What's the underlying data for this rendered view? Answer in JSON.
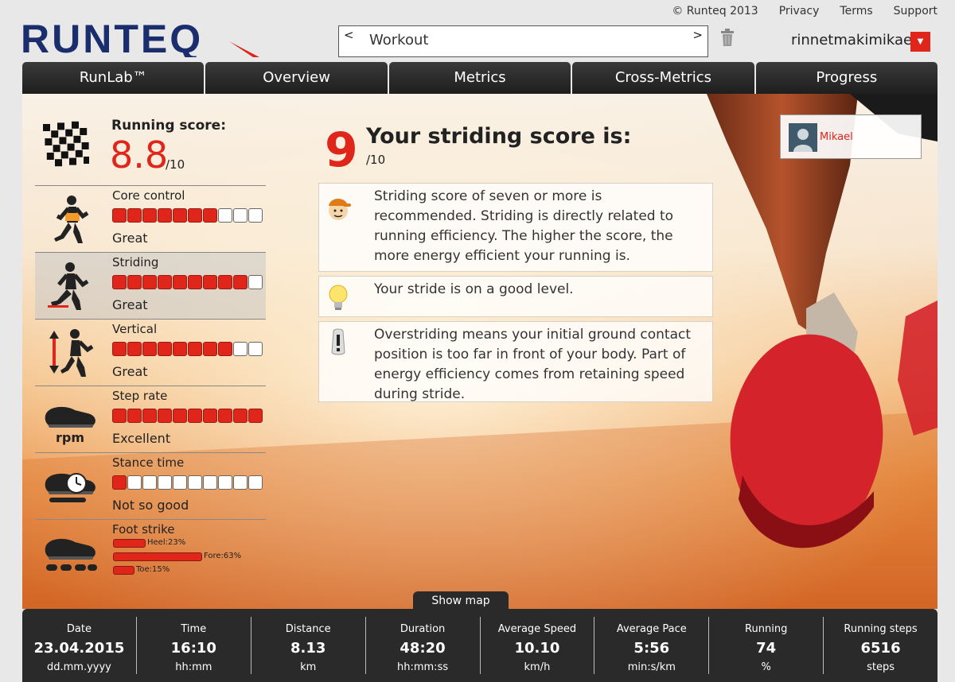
{
  "header": {
    "logo_text": "RUNTEQ",
    "copyright": "© Runteq 2013",
    "links": [
      "Privacy",
      "Terms",
      "Support"
    ],
    "workout": {
      "prev": "<",
      "next": ">",
      "label": "Workout"
    },
    "username": "rinnetmakimikael",
    "menu_glyph": "▼"
  },
  "nav": {
    "tabs": [
      "RunLab™",
      "Overview",
      "Metrics",
      "Cross-Metrics",
      "Progress"
    ]
  },
  "running_score": {
    "label": "Running score:",
    "value": "8.8",
    "max": "/10"
  },
  "metrics": [
    {
      "title": "Core control",
      "rating": "Great",
      "filled": 7,
      "total": 10,
      "icon": "core-runner-icon"
    },
    {
      "title": "Striding",
      "rating": "Great",
      "filled": 9,
      "total": 10,
      "icon": "striding-runner-icon"
    },
    {
      "title": "Vertical",
      "rating": "Great",
      "filled": 8,
      "total": 10,
      "icon": "vertical-runner-icon"
    },
    {
      "title": "Step rate",
      "rating": "Excellent",
      "filled": 10,
      "total": 10,
      "icon": "rpm-shoe-icon",
      "icon_text": "rpm"
    },
    {
      "title": "Stance time",
      "rating": "Not so good",
      "filled": 1,
      "total": 10,
      "icon": "stopwatch-shoe-icon"
    }
  ],
  "foot_strike": {
    "title": "Foot strike",
    "heel": {
      "label": "Heel:23%",
      "pct": 23
    },
    "fore": {
      "label": "Fore:63%",
      "pct": 63
    },
    "toe": {
      "label": "Toe:15%",
      "pct": 15
    }
  },
  "striding": {
    "score": "9",
    "title": "Your striding score is:",
    "max": "/10"
  },
  "tips": [
    {
      "icon": "coach-face-icon",
      "text": "Striding score of seven or more is recommended. Striding is directly related to running efficiency. The higher the score, the more energy efficient your running is."
    },
    {
      "icon": "lightbulb-icon",
      "text": "Your stride is on a good level."
    },
    {
      "icon": "exclamation-icon",
      "text": "Overstriding means your initial ground contact position is too far in front of your body. Part of energy efficiency comes from retaining speed during stride."
    }
  ],
  "profile": {
    "name": "Mikael"
  },
  "show_map_label": "Show map",
  "stats": [
    {
      "label": "Date",
      "value": "23.04.2015",
      "unit": "dd.mm.yyyy"
    },
    {
      "label": "Time",
      "value": "16:10",
      "unit": "hh:mm"
    },
    {
      "label": "Distance",
      "value": "8.13",
      "unit": "km"
    },
    {
      "label": "Duration",
      "value": "48:20",
      "unit": "hh:mm:ss"
    },
    {
      "label": "Average Speed",
      "value": "10.10",
      "unit": "km/h"
    },
    {
      "label": "Average Pace",
      "value": "5:56",
      "unit": "min:s/km"
    },
    {
      "label": "Running",
      "value": "74",
      "unit": "%"
    },
    {
      "label": "Running steps",
      "value": "6516",
      "unit": "steps"
    }
  ],
  "colors": {
    "accent": "#e0251b",
    "logo": "#1a2e6e",
    "dark_bar": "#2a2a2a"
  }
}
